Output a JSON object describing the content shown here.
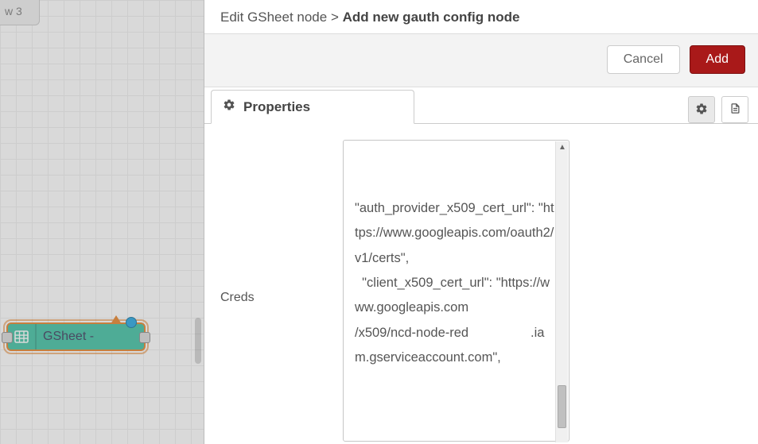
{
  "canvas": {
    "flow_tab_label": "w 3",
    "node_label": "GSheet -"
  },
  "tray": {
    "breadcrumb_prev": "Edit GSheet node",
    "breadcrumb_sep": ">",
    "breadcrumb_curr": "Add new gauth config node",
    "cancel_label": "Cancel",
    "add_label": "Add",
    "properties_tab_label": "Properties"
  },
  "form": {
    "creds_label": "Creds",
    "creds_value": "\"auth_provider_x509_cert_url\": \"https://www.googleapis.com/oauth2/v1/certs\",\n  \"client_x509_cert_url\": \"https://www.googleapis.com                           /x509/ncd-node-red                 .iam.gserviceaccount.com\","
  },
  "colors": {
    "primary": "#a91919",
    "node_fill": "#38bfa0",
    "node_border": "#e67e22",
    "indicator": "#1ca3e0"
  }
}
